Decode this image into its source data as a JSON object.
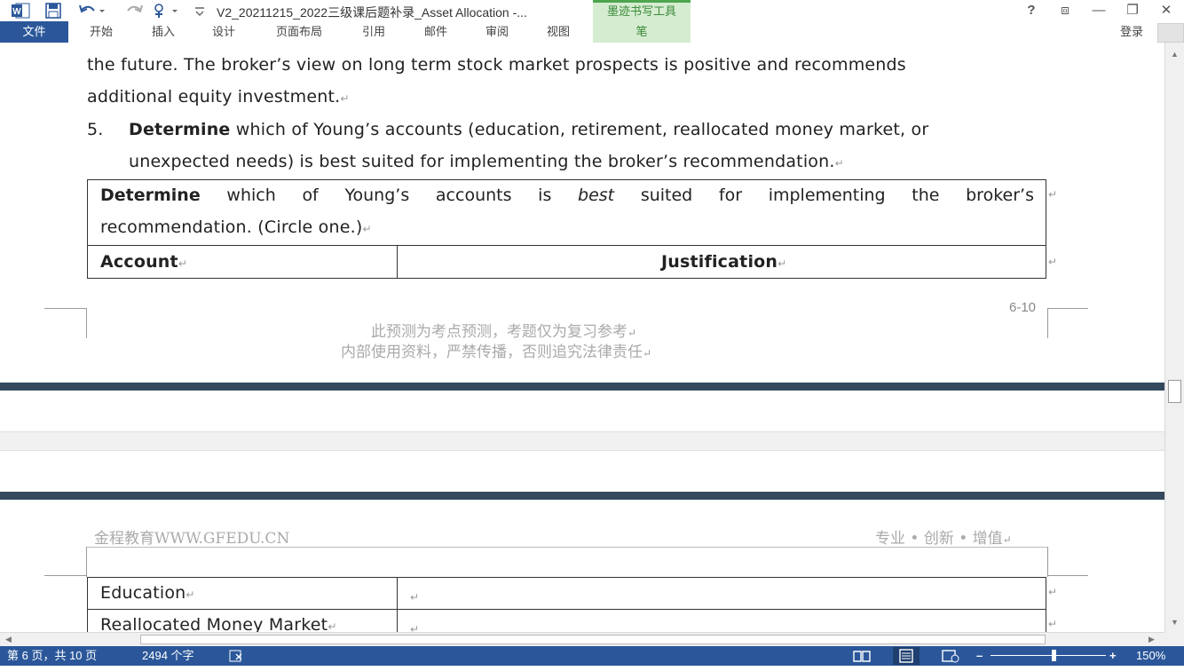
{
  "window": {
    "title": "V2_20211215_2022三级课后题补录_Asset Allocation -...",
    "contextual_group": "墨迹书写工具",
    "help": "?",
    "ribbon_display": "⧈",
    "minimize": "—",
    "restore": "❐",
    "close": "✕"
  },
  "ribbon": {
    "file": "文件",
    "tabs": [
      "开始",
      "插入",
      "设计",
      "页面布局",
      "引用",
      "邮件",
      "审阅",
      "视图"
    ],
    "pen_tab": "笔",
    "login": "登录"
  },
  "document": {
    "line1": "the future. The broker’s view on long term stock market prospects is positive and recommends",
    "line2": "additional equity investment.",
    "item_number": "5.",
    "item_bold": "Determine",
    "item_rest": " which of Young’s accounts (education, retirement, reallocated money market, or",
    "item_line2": "unexpected needs) is best suited for implementing the broker’s recommendation.",
    "table": {
      "prompt_bold": "Determine",
      "prompt_words": [
        "which",
        "of",
        "Young’s",
        "accounts",
        "is",
        "best",
        "suited",
        "for",
        "implementing",
        "the",
        "broker’s"
      ],
      "prompt_line2": "recommendation. (Circle one.)",
      "col1_header": "Account",
      "col2_header": "Justification",
      "rows": [
        "Education",
        "Reallocated Money Market"
      ]
    },
    "paragraph_mark": "↵",
    "page_number": "6-10",
    "footer_line1": "此预测为考点预测，考题仅为复习参考",
    "footer_line2": "内部使用资料，严禁传播，否则追究法律责任",
    "header_left": "金程教育WWW.GFEDU.CN",
    "header_right": "专业 • 创新 • 增值"
  },
  "statusbar": {
    "page": "第 6 页，共 10 页",
    "words": "2494 个字",
    "zoom": "150%"
  },
  "colors": {
    "accent": "#2b579a",
    "pen_group_bg": "#d5ecd0",
    "pen_group_text": "#3b8a3b",
    "page_separator": "#34495e"
  },
  "icons": [
    "word-app-icon",
    "save-icon",
    "undo-icon",
    "redo-icon",
    "touch-mode-icon",
    "customize-qat-icon",
    "proofing-icon",
    "read-mode-icon",
    "print-layout-icon",
    "web-layout-icon"
  ]
}
